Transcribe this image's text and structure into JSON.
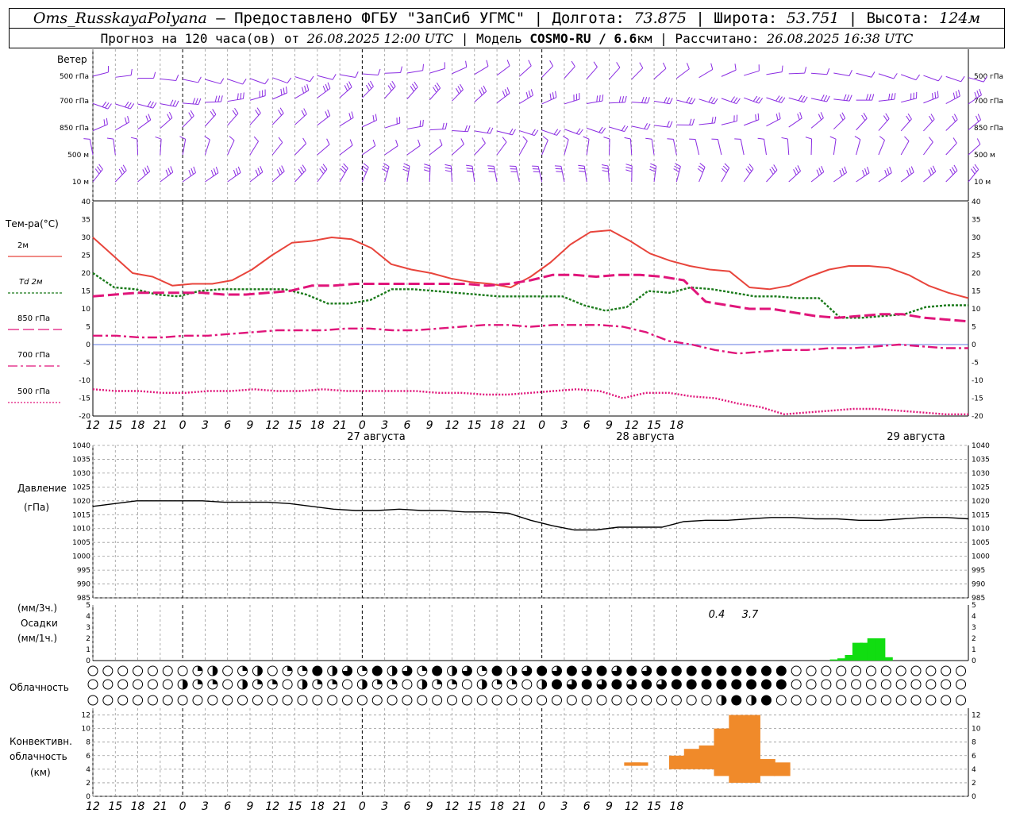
{
  "header": {
    "station": "Oms_RusskayaPolyana",
    "provided_by": "– Предоставлено ФГБУ \"ЗапСиб УГМС\" | Долгота:",
    "lon_value": "73.875",
    "lat_label": "| Широта:",
    "lat_value": "53.751",
    "alt_label": "| Высота:",
    "alt_value": "124м",
    "forecast_label": "Прогноз на 120 часа(ов) от",
    "forecast_start": "26.08.2025 12:00 UTC",
    "model_label": "| Модель",
    "model_name": "COSMO-RU / 6.6",
    "model_unit": "км | Рассчитано:",
    "computed": "26.08.2025 16:38 UTC"
  },
  "time_axis": {
    "hours": [
      "12",
      "15",
      "18",
      "21",
      "0",
      "3",
      "6",
      "9",
      "12",
      "15",
      "18",
      "21",
      "0",
      "3",
      "6",
      "9",
      "12",
      "15",
      "18",
      "21",
      "0",
      "3",
      "6",
      "9",
      "12",
      "15",
      "18"
    ],
    "dates": [
      "27 августа",
      "28 августа",
      "29 августа"
    ]
  },
  "wind_panel": {
    "title": "Ветер",
    "levels": [
      "500 гПа",
      "700 гПа",
      "850 гПа",
      "500 м",
      "10 м"
    ],
    "color": "#8a2be2"
  },
  "temp_panel": {
    "title": "Тем-ра(°C)",
    "legend": [
      {
        "label": "2м",
        "color": "#e8453c",
        "dash": "solid"
      },
      {
        "label": "Td 2м",
        "color": "#1a7a1a",
        "dash": "dot"
      },
      {
        "label": "850 гПа",
        "color": "#e0157a",
        "dash": "dash"
      },
      {
        "label": "700 гПа",
        "color": "#e0157a",
        "dash": "dashdot"
      },
      {
        "label": "500 гПа",
        "color": "#e0157a",
        "dash": "fine"
      }
    ],
    "ticks": [
      "40",
      "35",
      "30",
      "25",
      "20",
      "15",
      "10",
      "5",
      "0",
      "-5",
      "-10",
      "-15",
      "-20"
    ]
  },
  "pressure_panel": {
    "title": "Давление",
    "unit": "(гПа)",
    "ticks": [
      "1040",
      "1035",
      "1030",
      "1025",
      "1020",
      "1015",
      "1010",
      "1005",
      "1000",
      "995",
      "990",
      "985"
    ]
  },
  "precip_panel": {
    "unit_top": "(мм/3ч.)",
    "title": "Осадки",
    "unit_bottom": "(мм/1ч.)",
    "ticks": [
      "5",
      "4",
      "3",
      "2",
      "1",
      "0"
    ],
    "totals": [
      "0.4",
      "3.7"
    ]
  },
  "cloud_panel": {
    "title": "Облачность"
  },
  "conv_panel": {
    "title1": "Конвективн.",
    "title2": "облачность",
    "unit": "(км)",
    "ticks": [
      "12",
      "10",
      "8",
      "6",
      "4",
      "2",
      "0"
    ]
  },
  "chart_data": [
    {
      "type": "line",
      "title": "Тем-ра(°C)",
      "x_hours_from_start": [
        0,
        3,
        6,
        9,
        12,
        15,
        18,
        21,
        24,
        27,
        30,
        33,
        36,
        39,
        42,
        45,
        48,
        51,
        54,
        57,
        60,
        63,
        66,
        69,
        72,
        75,
        78,
        81,
        84,
        87,
        90,
        93,
        96,
        99,
        102,
        105,
        108,
        111,
        114,
        117
      ],
      "ylim": [
        -20,
        40
      ],
      "series": [
        {
          "name": "2м",
          "values": [
            30,
            25,
            20,
            19,
            16.5,
            17,
            17,
            18,
            21,
            25,
            28.5,
            29,
            30,
            29.5,
            27,
            22.5,
            21,
            20,
            18.5,
            17.5,
            17,
            16,
            19,
            23,
            28,
            31.5,
            32,
            29,
            25.5,
            23.5,
            22,
            21,
            20.5,
            16,
            15.5,
            16.5,
            19,
            21,
            22,
            22,
            21.5,
            19.5,
            16.5,
            14.5,
            13
          ]
        },
        {
          "name": "Td 2м",
          "values": [
            20,
            16,
            15.5,
            14,
            13.5,
            15,
            15.5,
            15.5,
            15.5,
            15.5,
            14,
            11.5,
            11.5,
            12.5,
            15.5,
            15.5,
            15,
            14.5,
            14,
            13.5,
            13.5,
            13.5,
            13.5,
            11,
            9.5,
            10.5,
            15,
            14.5,
            16,
            15.5,
            14.5,
            13.5,
            13.5,
            13,
            13,
            7.5,
            7.5,
            8,
            8.5,
            10.5,
            11,
            11
          ]
        },
        {
          "name": "850 гПа",
          "values": [
            13.5,
            14,
            14.5,
            14.5,
            14.5,
            14.5,
            14,
            14,
            14.5,
            15,
            16.5,
            16.5,
            17,
            17,
            17,
            17,
            17,
            17,
            16.5,
            17,
            18,
            19.5,
            19.5,
            19,
            19.5,
            19.5,
            19,
            18,
            12,
            11,
            10,
            10,
            9,
            8,
            7.5,
            8,
            8.5,
            8.5,
            7.5,
            7,
            6.5
          ]
        },
        {
          "name": "700 гПа",
          "values": [
            2.5,
            2.5,
            2,
            2,
            2.5,
            2.5,
            3,
            3.5,
            4,
            4,
            4,
            4.5,
            4.5,
            4,
            4,
            4.5,
            5,
            5.5,
            5.5,
            5,
            5.5,
            5.5,
            5.5,
            5,
            3.5,
            1,
            0,
            -1.5,
            -2.5,
            -2,
            -1.5,
            -1.5,
            -1,
            -1,
            -0.5,
            0,
            -0.5,
            -1,
            -1
          ]
        },
        {
          "name": "500 гПа",
          "values": [
            -12.5,
            -13,
            -13,
            -13.5,
            -13.5,
            -13,
            -13,
            -12.5,
            -13,
            -13,
            -12.5,
            -13,
            -13,
            -13,
            -13,
            -13.5,
            -13.5,
            -14,
            -14,
            -13.5,
            -13,
            -12.5,
            -13,
            -15,
            -13.5,
            -13.5,
            -14.5,
            -15,
            -16.5,
            -17.5,
            -19.5,
            -19,
            -18.5,
            -18,
            -18,
            -18.5,
            -19,
            -19.5,
            -19.5
          ]
        }
      ]
    },
    {
      "type": "line",
      "title": "Давление",
      "ylim": [
        985,
        1040
      ],
      "series": [
        {
          "name": "Давление",
          "values": [
            1018,
            1019,
            1020,
            1020,
            1020,
            1020,
            1019.5,
            1019.5,
            1019.5,
            1019,
            1018,
            1017,
            1016.5,
            1016.5,
            1017,
            1016.5,
            1016.5,
            1016,
            1016,
            1015.5,
            1013,
            1011,
            1009.5,
            1009.5,
            1010.5,
            1010.5,
            1010.5,
            1012.5,
            1013,
            1013,
            1013.5,
            1014,
            1014,
            1013.5,
            1013.5,
            1013,
            1013,
            1013.5,
            1014,
            1014,
            1013.5
          ]
        }
      ]
    },
    {
      "type": "bar",
      "title": "Осадки",
      "ylim": [
        0,
        5
      ],
      "x_hours_from_start": [
        99,
        100,
        101,
        102,
        103,
        104,
        105,
        106
      ],
      "values": [
        0.1,
        0.2,
        0.5,
        1.6,
        1.6,
        2.0,
        2.0,
        0.3
      ]
    },
    {
      "type": "bar",
      "title": "Конвективн. облачность",
      "ylim": [
        0,
        13
      ],
      "bars": [
        {
          "hour": 72,
          "bottom": 4.5,
          "top": 5.0
        },
        {
          "hour": 73,
          "bottom": 4.5,
          "top": 5.0
        },
        {
          "hour": 78,
          "bottom": 4.0,
          "top": 6.0
        },
        {
          "hour": 80,
          "bottom": 4.0,
          "top": 7.0
        },
        {
          "hour": 82,
          "bottom": 4.0,
          "top": 7.5
        },
        {
          "hour": 84,
          "bottom": 3.0,
          "top": 10.0
        },
        {
          "hour": 86,
          "bottom": 2.0,
          "top": 12.0
        },
        {
          "hour": 88,
          "bottom": 2.0,
          "top": 12.0
        },
        {
          "hour": 90,
          "bottom": 3.0,
          "top": 5.5
        },
        {
          "hour": 92,
          "bottom": 3.0,
          "top": 5.0
        }
      ]
    }
  ]
}
